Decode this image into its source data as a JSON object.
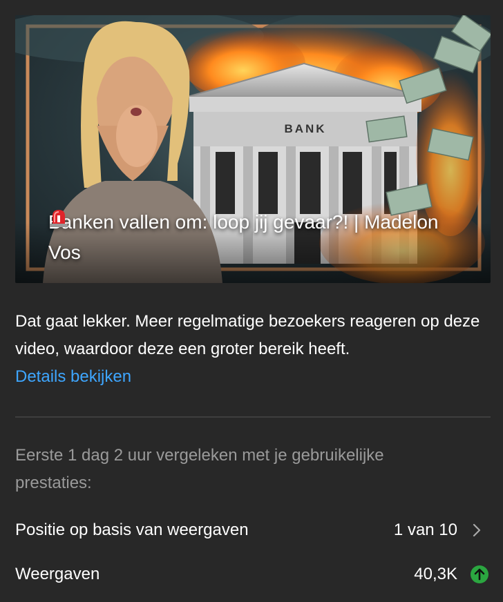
{
  "video": {
    "title": "Banken vallen om: loop jij gevaar?! | Madelon Vos",
    "title_emoji_icon": "siren-icon",
    "thumbnail_sign_text": "BANK"
  },
  "insight": {
    "message": "Dat gaat lekker. Meer regelmatige bezoekers reageren op deze video, waardoor deze een groter bereik heeft.",
    "details_link": "Details bekijken"
  },
  "comparison": {
    "intro": "Eerste 1 dag 2 uur vergeleken met je gebruikelijke prestaties:"
  },
  "metrics": [
    {
      "label": "Positie op basis van weergaven",
      "value": "1 van 10",
      "icon": "chevron-right-icon"
    },
    {
      "label": "Weergaven",
      "value": "40,3K",
      "icon": "arrow-up-icon",
      "icon_color": "#2ba640"
    }
  ],
  "colors": {
    "background": "#282828",
    "link": "#3ea6ff",
    "secondary_text": "#9a9a9a",
    "positive": "#2ba640"
  }
}
